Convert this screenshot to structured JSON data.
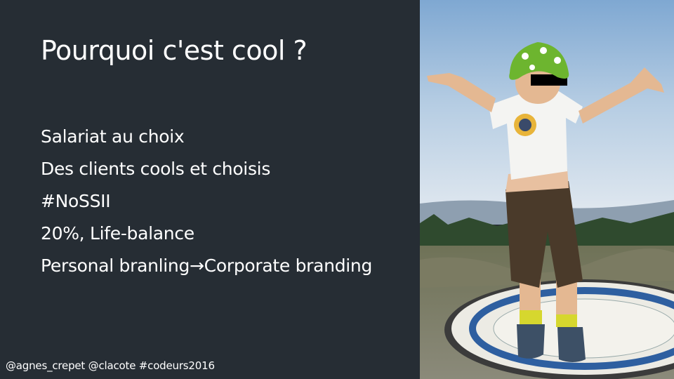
{
  "slide": {
    "title": "Pourquoi c'est cool ?",
    "bullets": [
      "Salariat au choix",
      "Des clients cools et choisis",
      "#NoSSII",
      "20%, Life-balance",
      "Personal branling→Corporate branding"
    ],
    "footer": "@agnes_crepet @clacote #codeurs2016"
  },
  "colors": {
    "background": "#262d34",
    "text": "#ffffff",
    "sky": "#8fb3d6"
  }
}
